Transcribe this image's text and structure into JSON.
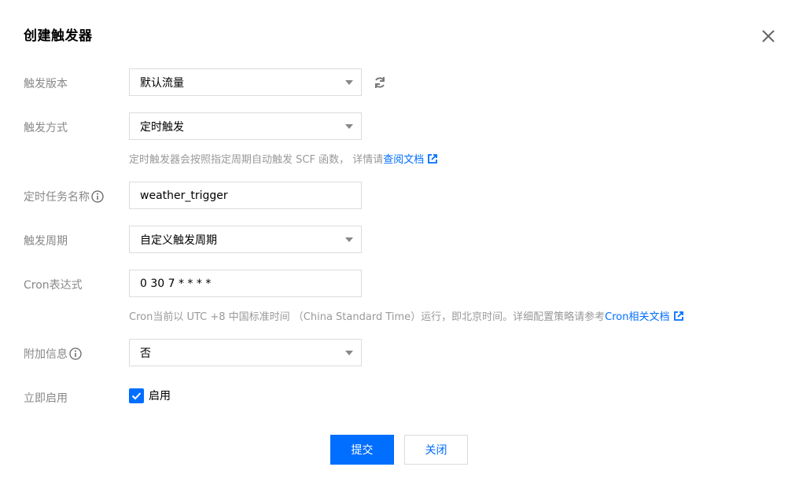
{
  "dialog": {
    "title": "创建触发器"
  },
  "fields": {
    "version": {
      "label": "触发版本",
      "value": "默认流量"
    },
    "method": {
      "label": "触发方式",
      "value": "定时触发",
      "help_text": "定时触发器会按照指定周期自动触发 SCF 函数， 详情请",
      "help_link": "查阅文档"
    },
    "task_name": {
      "label": "定时任务名称",
      "value": "weather_trigger"
    },
    "period": {
      "label": "触发周期",
      "value": "自定义触发周期"
    },
    "cron": {
      "label": "Cron表达式",
      "value": "0 30 7 * * * *",
      "help_text": "Cron当前以 UTC +8 中国标准时间 （China Standard Time）运行，即北京时间。详细配置策略请参考",
      "help_link": "Cron相关文档"
    },
    "extra": {
      "label": "附加信息",
      "value": "否"
    },
    "enable": {
      "label": "立即启用",
      "checkbox_label": "启用",
      "checked": true
    }
  },
  "buttons": {
    "submit": "提交",
    "close": "关闭"
  },
  "colors": {
    "accent": "#006eff",
    "label": "#888888",
    "border": "#dcdcdc"
  },
  "icons": [
    "close-icon",
    "refresh-icon",
    "info-icon",
    "external-link-icon",
    "chevron-down-icon",
    "checkmark-icon"
  ]
}
